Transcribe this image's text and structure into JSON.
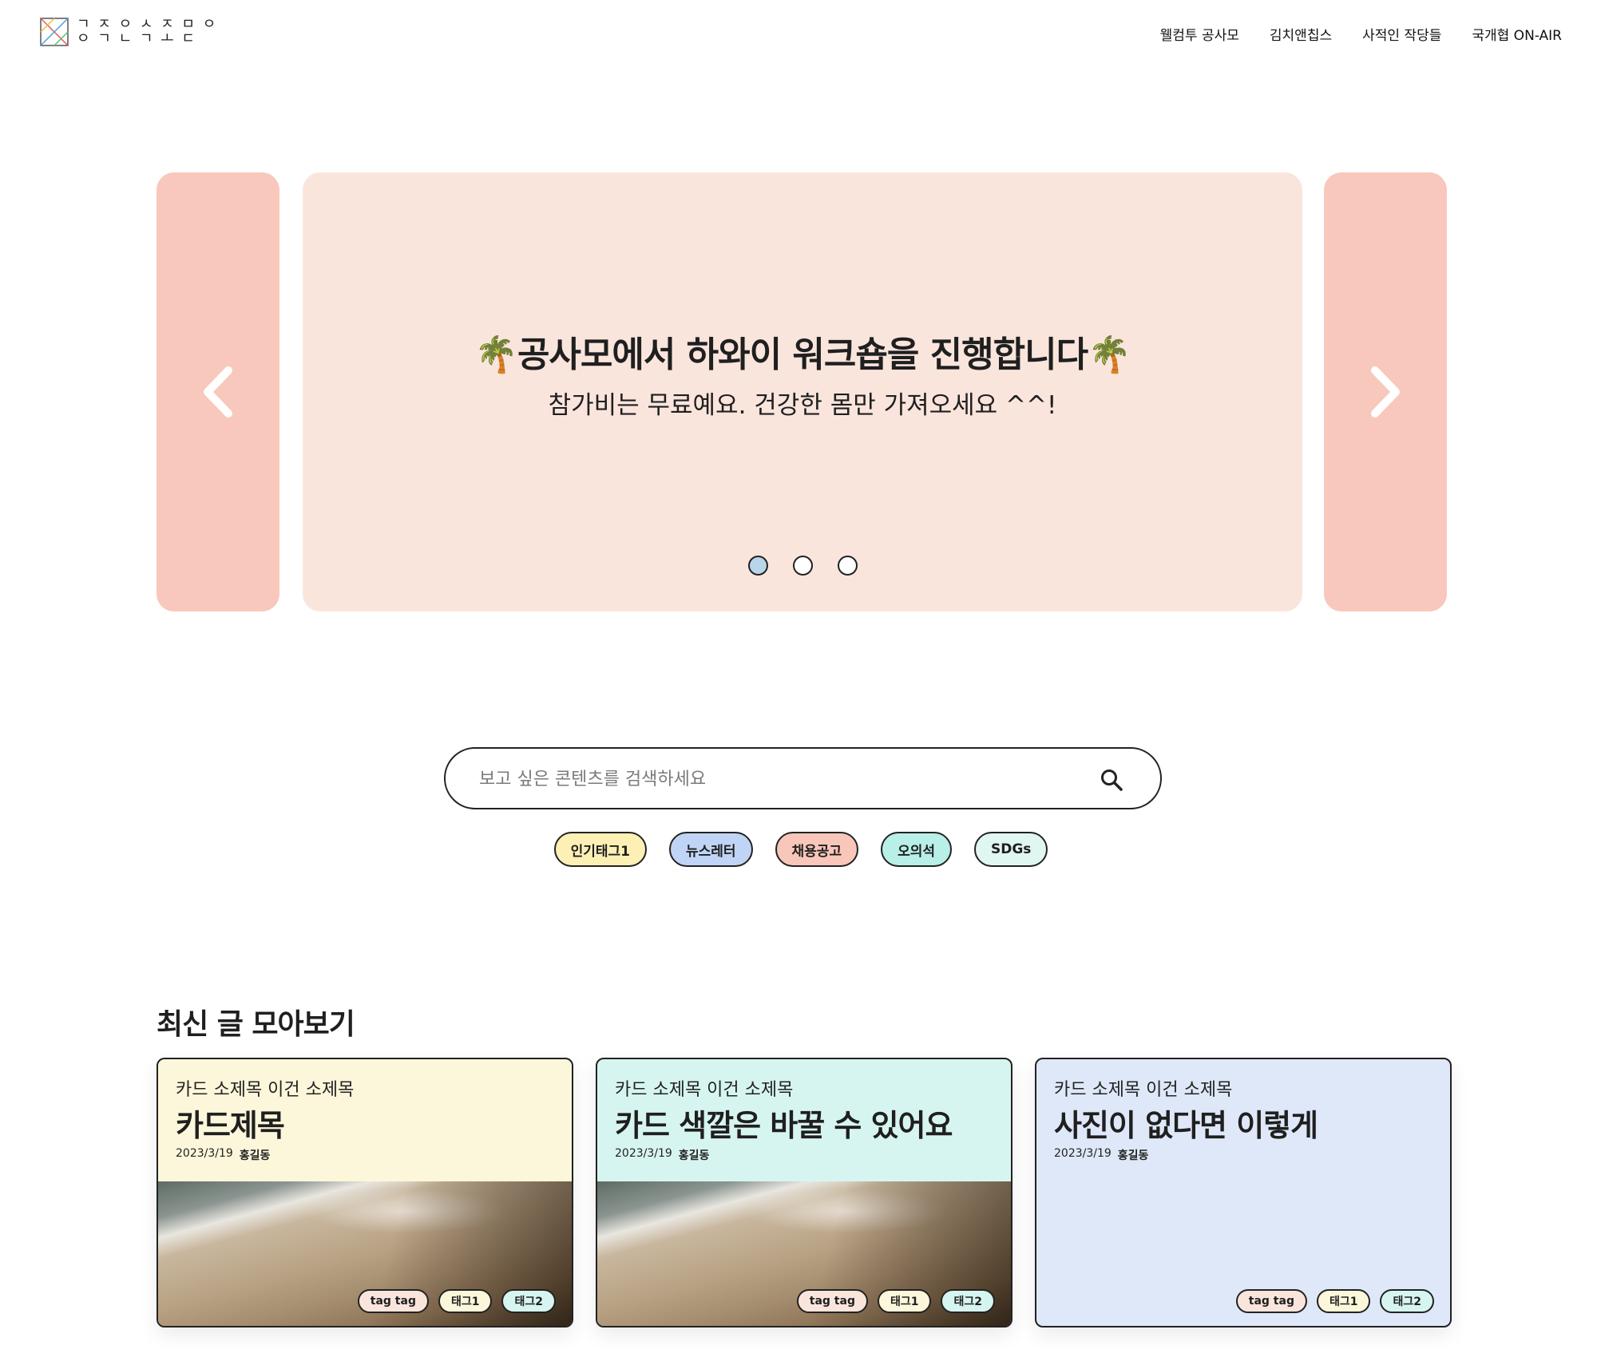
{
  "header": {
    "logo_top": "ㄱ ㅈ ㅇ ㅅ ㅈ ㅁ ㅇ",
    "logo_bottom": "ㅇ ㄱ ㄴ ㄱ ㅗ ㄷ",
    "nav": [
      "웰컴투 공사모",
      "김치앤칩스",
      "사적인 작당들",
      "국개협 ON-AIR"
    ]
  },
  "slider": {
    "title": "🌴공사모에서 하와이 워크숍을 진행합니다🌴",
    "subtitle": "참가비는 무료예요. 건강한 몸만 가져오세요 ^^!",
    "dots_total": 3,
    "active_dot": 1,
    "colors": {
      "side": "#f8c8bc",
      "main": "#fae5dd",
      "active_dot": "#b8d6e8"
    }
  },
  "search": {
    "placeholder": "보고 싶은 콘텐츠를 검색하세요",
    "value": ""
  },
  "tags": [
    {
      "label": "인기태그1",
      "color": "#fdf0b5"
    },
    {
      "label": "뉴스레터",
      "color": "#c0d4f5"
    },
    {
      "label": "채용공고",
      "color": "#f9c6ba"
    },
    {
      "label": "오의석",
      "color": "#b8efe6"
    },
    {
      "label": "SDGs",
      "color": "#e0f7f1"
    }
  ],
  "section": {
    "title": "최신 글 모아보기"
  },
  "cards": [
    {
      "subtitle": "카드 소제목 이건 소제목",
      "title": "카드제목",
      "date": "2023/3/19",
      "author": "홍길동",
      "bg": "#fcf7da",
      "has_image": true,
      "tags": [
        {
          "label": "tag tag",
          "color": "#fae5dd"
        },
        {
          "label": "태그1",
          "color": "#fcf7da"
        },
        {
          "label": "태그2",
          "color": "#d7f5f0"
        }
      ]
    },
    {
      "subtitle": "카드 소제목 이건 소제목",
      "title": "카드 색깔은 바꿀 수 있어요",
      "date": "2023/3/19",
      "author": "홍길동",
      "bg": "#d7f5f0",
      "has_image": true,
      "tags": [
        {
          "label": "tag tag",
          "color": "#fae5dd"
        },
        {
          "label": "태그1",
          "color": "#fcf7da"
        },
        {
          "label": "태그2",
          "color": "#d7f5f0"
        }
      ]
    },
    {
      "subtitle": "카드 소제목 이건 소제목",
      "title": "사진이 없다면 이렇게",
      "date": "2023/3/19",
      "author": "홍길동",
      "bg": "#dee8f8",
      "has_image": false,
      "tags": [
        {
          "label": "tag tag",
          "color": "#fae5dd"
        },
        {
          "label": "태그1",
          "color": "#fcf7da"
        },
        {
          "label": "태그2",
          "color": "#d7f5f0"
        }
      ]
    }
  ]
}
